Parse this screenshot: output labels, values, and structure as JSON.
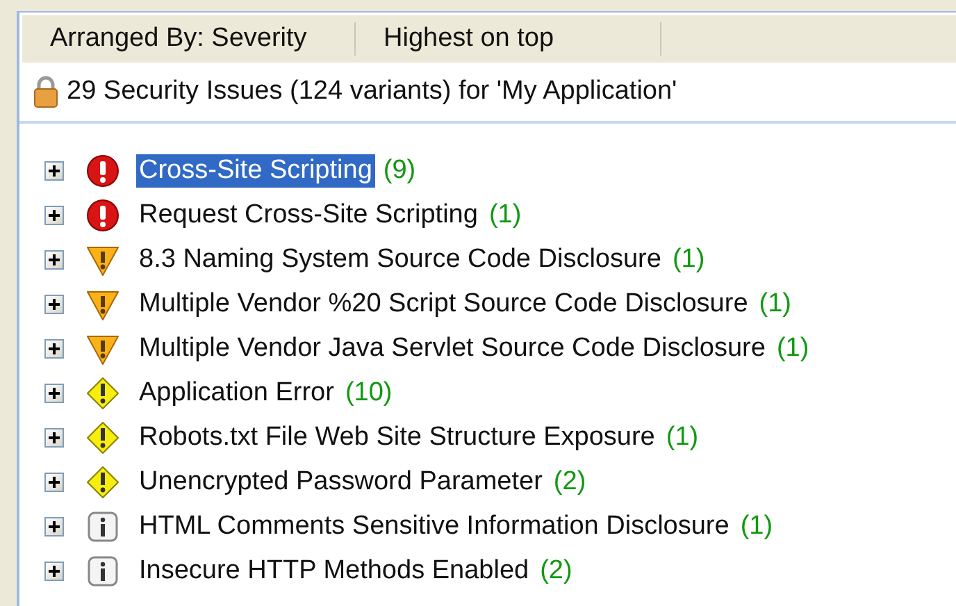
{
  "toolbar": {
    "items": [
      "Arranged By: Severity",
      "Highest on top"
    ]
  },
  "summary": "29 Security Issues (124 variants) for 'My Application'",
  "issues": [
    {
      "kind": "high",
      "title": "Cross-Site Scripting",
      "count": "(9)",
      "selected": true,
      "expanded": false
    },
    {
      "kind": "high",
      "title": "Request Cross-Site Scripting",
      "count": "(1)",
      "selected": false,
      "expanded": false
    },
    {
      "kind": "medium",
      "title": "8.3 Naming System Source Code Disclosure",
      "count": "(1)",
      "selected": false,
      "expanded": false
    },
    {
      "kind": "medium",
      "title": "Multiple Vendor %20 Script Source Code Disclosure",
      "count": "(1)",
      "selected": false,
      "expanded": false
    },
    {
      "kind": "medium",
      "title": "Multiple Vendor Java Servlet Source Code Disclosure",
      "count": "(1)",
      "selected": false,
      "expanded": false
    },
    {
      "kind": "low",
      "title": "Application Error",
      "count": "(10)",
      "selected": false,
      "expanded": false
    },
    {
      "kind": "low",
      "title": "Robots.txt File Web Site Structure Exposure",
      "count": "(1)",
      "selected": false,
      "expanded": false
    },
    {
      "kind": "low",
      "title": "Unencrypted Password Parameter",
      "count": "(2)",
      "selected": false,
      "expanded": false
    },
    {
      "kind": "info",
      "title": "HTML Comments Sensitive Information Disclosure",
      "count": "(1)",
      "selected": false,
      "expanded": false
    },
    {
      "kind": "info",
      "title": "Insecure HTTP Methods Enabled",
      "count": "(2)",
      "selected": false,
      "expanded": false
    }
  ]
}
